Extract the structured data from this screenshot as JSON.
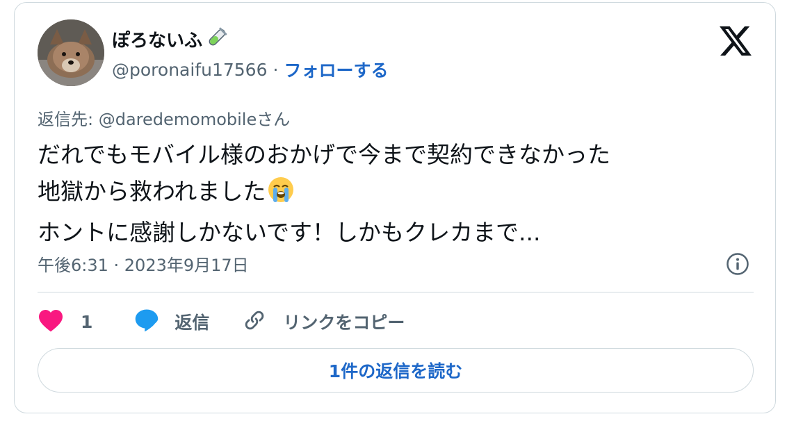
{
  "author": {
    "display_name": "ぽろないふ",
    "display_name_emoji": "test-tube-icon",
    "handle": "@poronaifu17566",
    "separator": "·",
    "follow_label": "フォローする"
  },
  "reply_to": "返信先: @daredemomobileさん",
  "tweet": {
    "lines": [
      "だれでもモバイル様のおかげで今まで契約できなかった",
      "地獄から救われました",
      "ホントに感謝しかないです！しかもクレカまで..."
    ],
    "emoji": "loudly-crying-face-icon"
  },
  "timestamp": "午後6:31 · 2023年9月17日",
  "actions": {
    "like_count": "1",
    "reply_label": "返信",
    "copy_link_label": "リンクをコピー"
  },
  "read_replies_label": "1件の返信を読む",
  "colors": {
    "link_blue": "#1d67c8",
    "heart_pink": "#f91880",
    "reply_blue": "#1d9bf0",
    "secondary_text": "#536471",
    "border": "#cfd9de"
  }
}
